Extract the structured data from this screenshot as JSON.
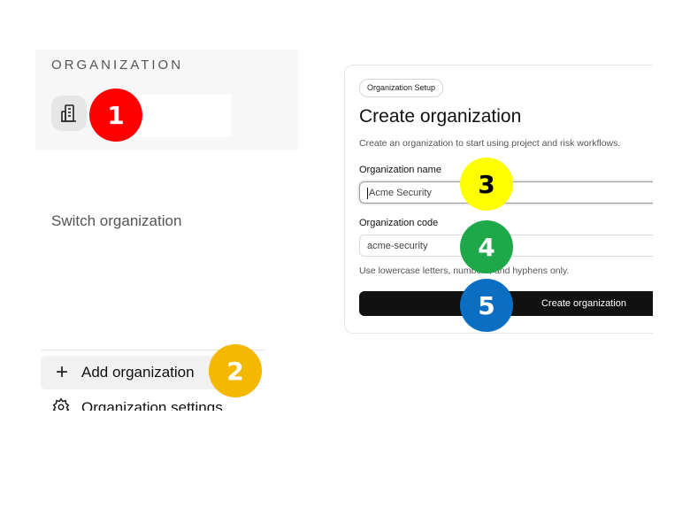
{
  "sidebar": {
    "section_label": "ORGANIZATION",
    "switch_label": "Switch organization",
    "add_org_label": "Add organization",
    "org_settings_label": "Organization settings"
  },
  "card": {
    "chip": "Organization Setup",
    "title": "Create organization",
    "description": "Create an organization to start using project and risk workflows.",
    "name_label": "Organization name",
    "name_value": "Acme Security",
    "code_label": "Organization code",
    "code_value": "acme-security",
    "helper": "Use lowercase letters, numbers, and hyphens only.",
    "submit_label": "Create organization"
  },
  "markers": [
    {
      "label": "1",
      "color": "#ff0000",
      "text_color": "#ffffff"
    },
    {
      "label": "2",
      "color": "#f5b800",
      "text_color": "#ffffff"
    },
    {
      "label": "3",
      "color": "#ffff00",
      "text_color": "#000000"
    },
    {
      "label": "4",
      "color": "#1fa84a",
      "text_color": "#ffffff"
    },
    {
      "label": "5",
      "color": "#0a6fc2",
      "text_color": "#ffffff"
    }
  ]
}
